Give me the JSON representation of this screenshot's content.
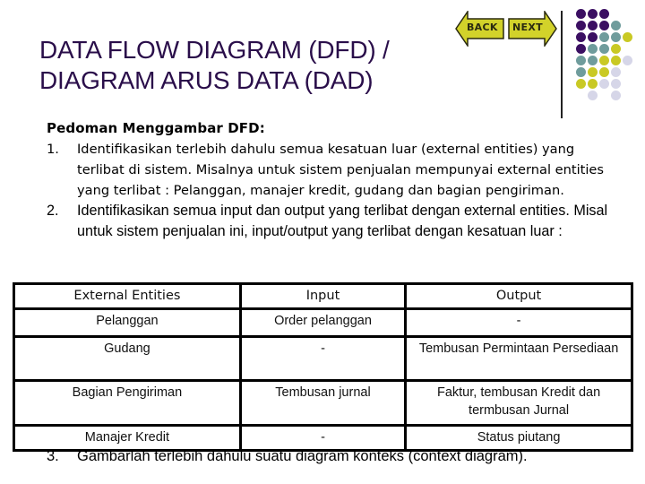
{
  "title": {
    "line1": "DATA FLOW DIAGRAM (DFD) /",
    "line2": "DIAGRAM ARUS DATA (DAD)"
  },
  "navigation": {
    "back_label": "BACK",
    "next_label": "NEXT",
    "button_color": "#d2d22a"
  },
  "decoration": {
    "dot_colors": {
      "P": "#3b0f62",
      "T": "#6f9c9c",
      "Y": "#c9c924",
      "L": "#d6d6e8"
    },
    "dot_grid": [
      "PPP..",
      "PPPT.",
      "PPTTY",
      "PTTY.",
      "TTYYL",
      "TYYL.",
      "YYLL.",
      ".L.L."
    ]
  },
  "content": {
    "heading": "Pedoman Menggambar DFD:",
    "items": [
      {
        "number": "1.",
        "text": "Identifikasikan terlebih dahulu semua kesatuan luar (external entities) yang terlibat di sistem. Misalnya untuk sistem penjualan mempunyai external entities yang terlibat : Pelanggan, manajer kredit, gudang dan bagian pengiriman."
      },
      {
        "number": "2.",
        "text": "Identifikasikan semua input dan output yang terlibat dengan external entities. Misal untuk sistem penjualan ini, input/output yang terlibat dengan kesatuan luar :"
      },
      {
        "number": "3.",
        "text": "Gambarlah terlebih dahulu suatu diagram konteks (context diagram)."
      }
    ]
  },
  "table": {
    "headers": [
      "External Entities",
      "Input",
      "Output"
    ],
    "rows": [
      [
        "Pelanggan",
        "Order pelanggan",
        "-"
      ],
      [
        "Gudang",
        "-",
        "Tembusan Permintaan Persediaan"
      ],
      [
        "Bagian Pengiriman",
        "Tembusan jurnal",
        "Faktur, tembusan Kredit dan termbusan Jurnal"
      ],
      [
        "Manajer Kredit",
        "-",
        "Status piutang"
      ]
    ]
  }
}
